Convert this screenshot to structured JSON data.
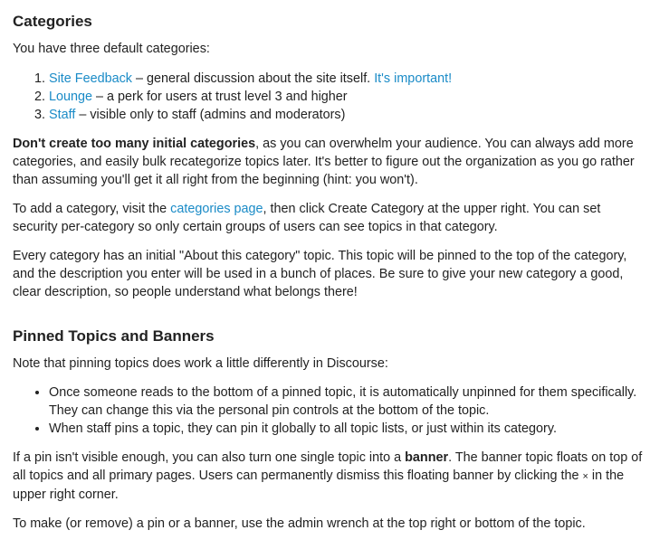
{
  "categories_section": {
    "heading": "Categories",
    "intro": "You have three default categories:",
    "items": [
      {
        "link": "Site Feedback",
        "text": " – general discussion about the site itself. ",
        "extra_link": "It's important!"
      },
      {
        "link": "Lounge",
        "text": " – a perk for users at trust level 3 and higher"
      },
      {
        "link": "Staff",
        "text": " – visible only to staff (admins and moderators)"
      }
    ],
    "para1_bold": "Don't create too many initial categories",
    "para1_rest": ", as you can overwhelm your audience. You can always add more categories, and easily bulk recategorize topics later. It's better to figure out the organization as you go rather than assuming you'll get it all right from the beginning (hint: you won't).",
    "para2_pre": "To add a category, visit the ",
    "para2_link": "categories page",
    "para2_post": ", then click Create Category at the upper right. You can set security per-category so only certain groups of users can see topics in that category.",
    "para3": "Every category has an initial \"About this category\" topic. This topic will be pinned to the top of the category, and the description you enter will be used in a bunch of places. Be sure to give your new category a good, clear description, so people understand what belongs there!"
  },
  "pinned_section": {
    "heading": "Pinned Topics and Banners",
    "intro": "Note that pinning topics does work a little differently in Discourse:",
    "bullets": [
      "Once someone reads to the bottom of a pinned topic, it is automatically unpinned for them specifically. They can change this via the personal pin controls at the bottom of the topic.",
      "When staff pins a topic, they can pin it globally to all topic lists, or just within its category."
    ],
    "para1_pre": "If a pin isn't visible enough, you can also turn one single topic into a ",
    "para1_bold": "banner",
    "para1_mid": ". The banner topic floats on top of all topics and all primary pages. Users can permanently dismiss this floating banner by clicking the ",
    "para1_x": "×",
    "para1_post": " in the upper right corner.",
    "para2": "To make (or remove) a pin or a banner, use the admin wrench at the top right or bottom of the topic."
  },
  "colors": {
    "link": "#1a8bc7",
    "text": "#222222"
  }
}
